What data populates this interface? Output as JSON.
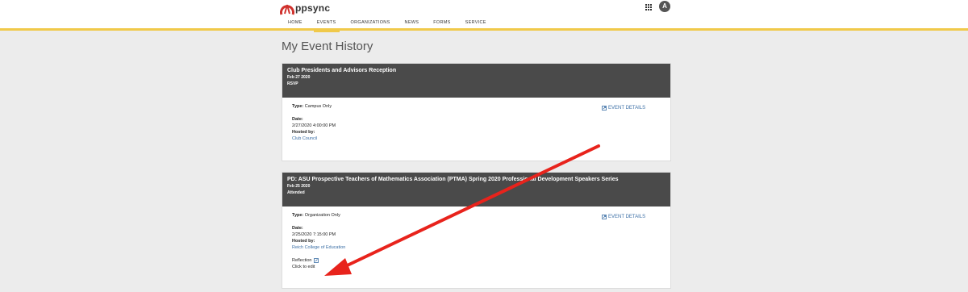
{
  "app": {
    "logo_text": "ppsync"
  },
  "nav": [
    {
      "label": "HOME"
    },
    {
      "label": "EVENTS"
    },
    {
      "label": "ORGANIZATIONS"
    },
    {
      "label": "NEWS"
    },
    {
      "label": "FORMS"
    },
    {
      "label": "SERVICE"
    }
  ],
  "user": {
    "avatar_initial": "A"
  },
  "page": {
    "title": "My Event History"
  },
  "events": [
    {
      "title": "Club Presidents and Advisors Reception",
      "date_short": "Feb 27 2020",
      "status": "RSVP",
      "type_label": "Type:",
      "type_value": "Campus Only",
      "date_label": "Date:",
      "date_value": "2/27/2020 4:00:00 PM",
      "hosted_label": "Hosted by:",
      "hosted_value": "Club Council",
      "details_label": "EVENT DETAILS"
    },
    {
      "title": "PD: ASU Prospective Teachers of Mathematics Association (PTMA) Spring 2020 Professional Development Speakers Series",
      "date_short": "Feb 25 2020",
      "status": "Attended",
      "type_label": "Type:",
      "type_value": "Organization Only",
      "date_label": "Date:",
      "date_value": "2/25/2020 7:15:00 PM",
      "hosted_label": "Hosted by:",
      "hosted_value": "Reich College of Education",
      "details_label": "EVENT DETAILS",
      "reflection_label": "Reflection",
      "reflection_hint": "Click to edit"
    }
  ],
  "colors": {
    "accent": "#f0c94a",
    "header_bg": "#4a4a4a",
    "link": "#3a6ea5",
    "annotation_arrow": "#e8231c"
  },
  "icons": [
    "appsync-logo-icon",
    "apps-grid-icon",
    "external-link-icon",
    "edit-icon",
    "annotation-arrow"
  ]
}
